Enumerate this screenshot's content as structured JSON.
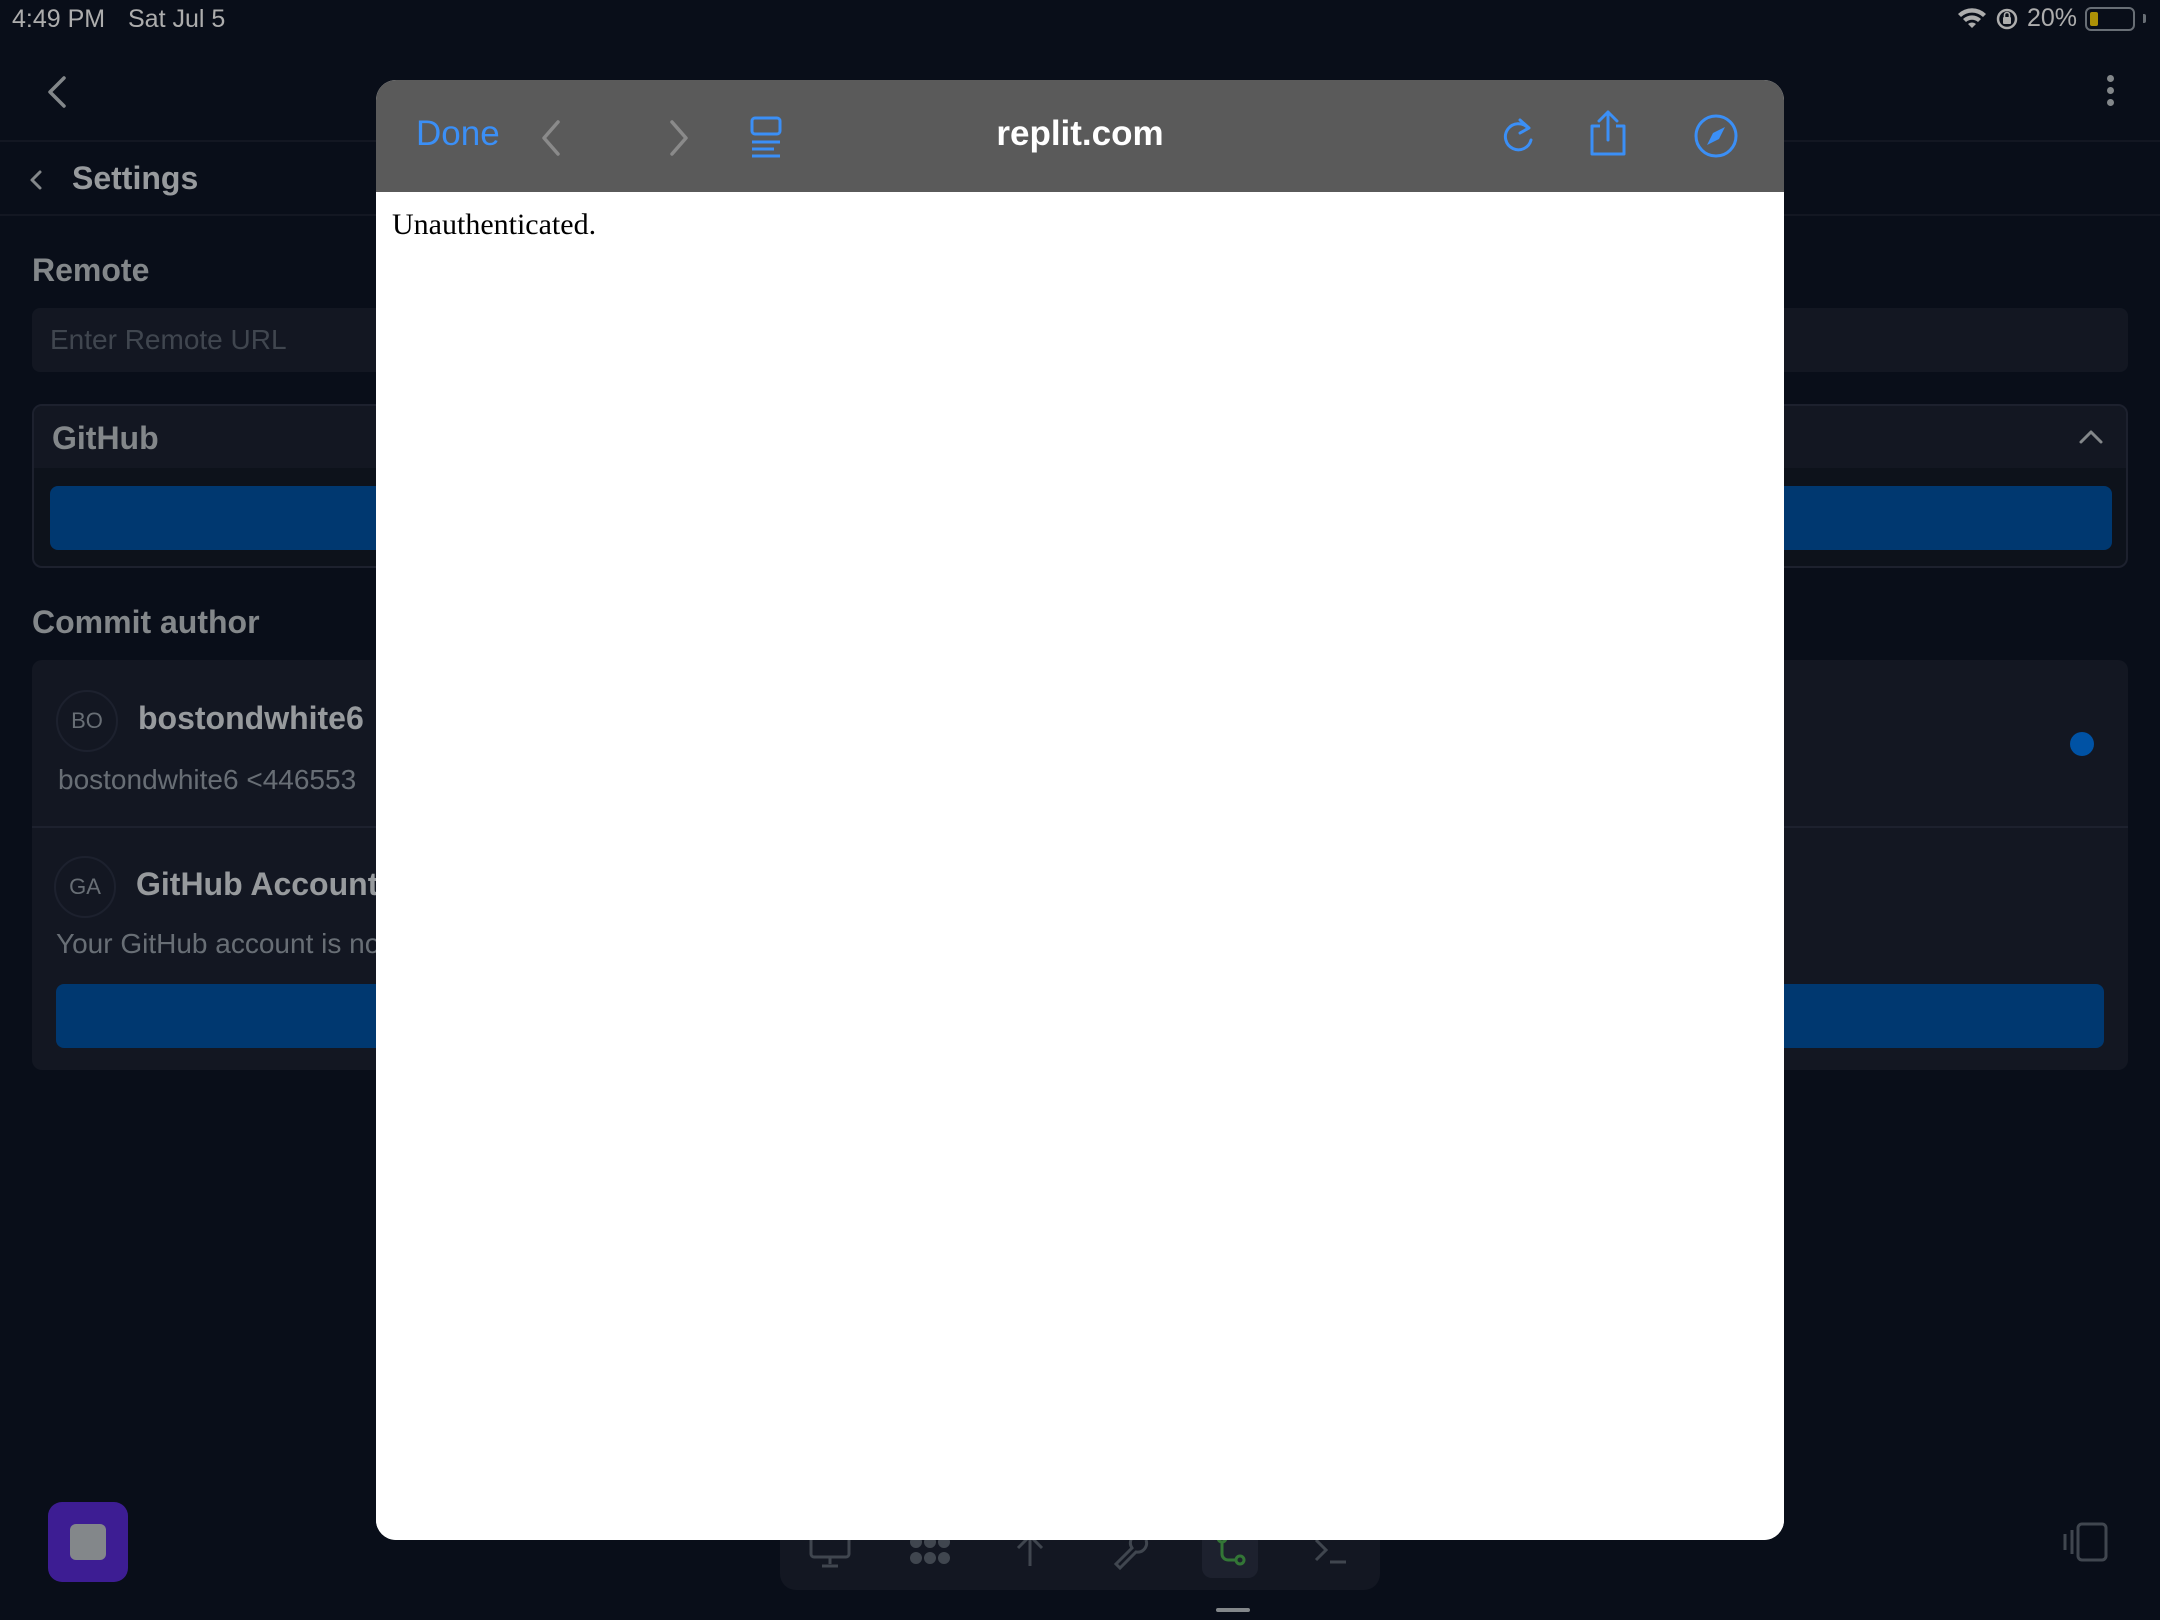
{
  "status_bar": {
    "time": "4:49 PM",
    "date": "Sat Jul 5",
    "battery_percent": "20%",
    "battery_level": 0.2,
    "icons": [
      "wifi-icon",
      "orientation-lock-icon",
      "battery-icon"
    ]
  },
  "settings": {
    "title": "Settings"
  },
  "remote": {
    "label": "Remote",
    "placeholder": "Enter Remote URL"
  },
  "github": {
    "title": "GitHub"
  },
  "commit_author": {
    "label": "Commit author",
    "authors": [
      {
        "initials": "BO",
        "name": "bostondwhite6",
        "detail": "bostondwhite6 <446553",
        "selected": true
      },
      {
        "initials": "GA",
        "name": "GitHub Account",
        "detail": "Your GitHub account is no"
      }
    ]
  },
  "browser_sheet": {
    "done_label": "Done",
    "url": "replit.com",
    "page_text": "Unauthenticated."
  },
  "colors": {
    "accent": "#3b8ff6",
    "primary_button": "#0053a6",
    "background": "#0e1525",
    "fab": "#5b2bd9"
  }
}
